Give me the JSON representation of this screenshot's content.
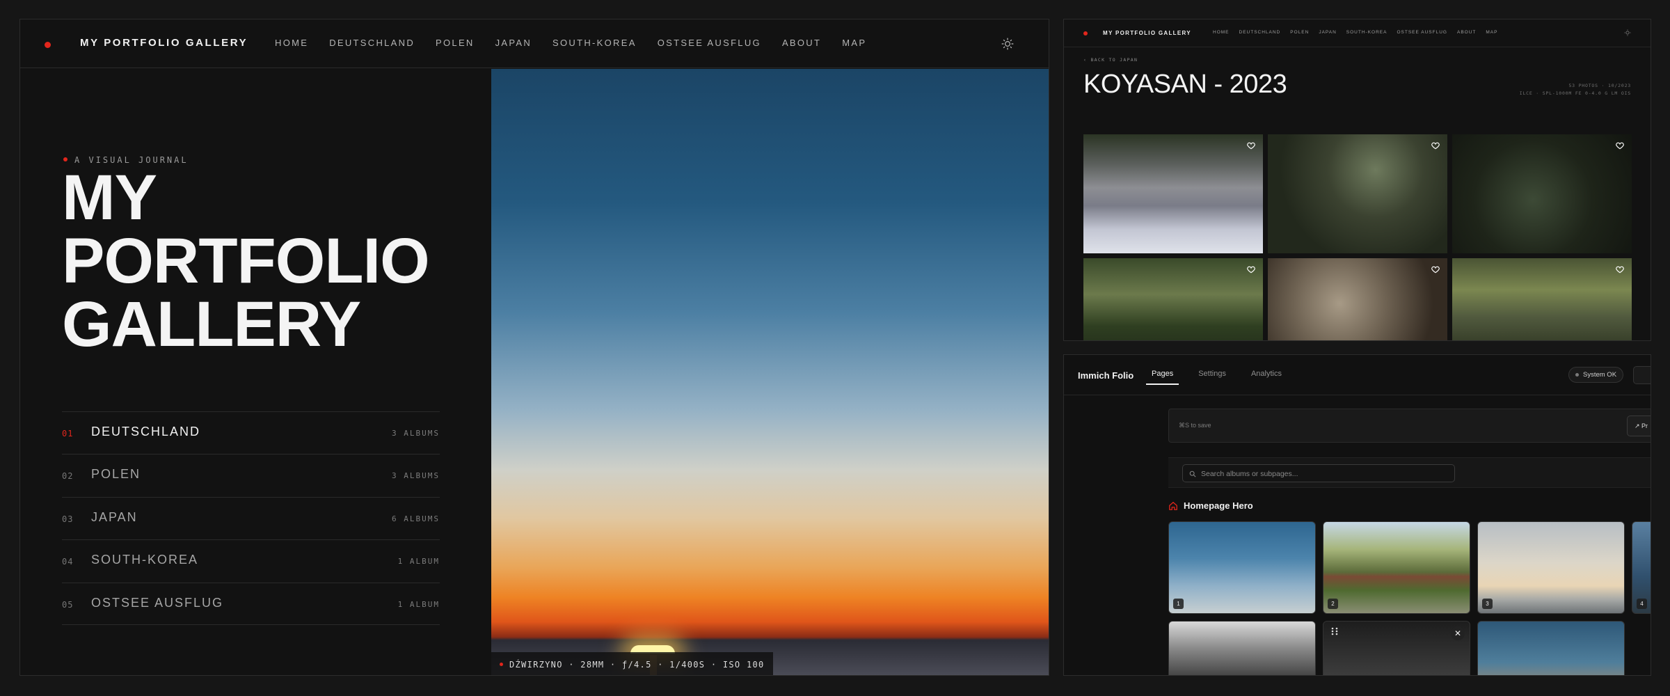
{
  "site": {
    "brand": "MY PORTFOLIO GALLERY",
    "nav": [
      "HOME",
      "DEUTSCHLAND",
      "POLEN",
      "JAPAN",
      "SOUTH-KOREA",
      "OSTSEE AUSFLUG",
      "ABOUT",
      "MAP"
    ],
    "icons": {
      "theme_toggle": "sun-icon",
      "album_like": "heart-icon"
    },
    "accent_color": "#e2261c"
  },
  "home": {
    "kicker": "A VISUAL JOURNAL",
    "title_lines": [
      "MY",
      "PORTFOLIO",
      "GALLERY"
    ],
    "countries": [
      {
        "num": "01",
        "name": "DEUTSCHLAND",
        "count": "3 ALBUMS",
        "active": true
      },
      {
        "num": "02",
        "name": "POLEN",
        "count": "3 ALBUMS",
        "active": false
      },
      {
        "num": "03",
        "name": "JAPAN",
        "count": "6 ALBUMS",
        "active": false
      },
      {
        "num": "04",
        "name": "SOUTH-KOREA",
        "count": "1 ALBUM",
        "active": false
      },
      {
        "num": "05",
        "name": "OSTSEE AUSFLUG",
        "count": "1 ALBUM",
        "active": false
      }
    ],
    "hero_exif": "DŹWIRZYNO · 28MM · ƒ/4.5 · 1/400S · ISO 100"
  },
  "album": {
    "back_label": "BACK TO JAPAN",
    "title": "KOYASAN - 2023",
    "meta_line1": "53 PHOTOS · 10/2023",
    "meta_line2": "ILCE · SPL-1000M FE 0-4.0 G LM OIS",
    "photos": 6
  },
  "cms": {
    "brand": "Immich Folio",
    "tabs": [
      {
        "label": "Pages",
        "active": true
      },
      {
        "label": "Settings",
        "active": false
      },
      {
        "label": "Analytics",
        "active": false
      }
    ],
    "status": "System OK",
    "save_hint": "⌘S to save",
    "preview_label": "↗ Pr",
    "search_placeholder": "Search albums or subpages...",
    "section_title": "Homepage Hero",
    "hero_tiles": [
      "1",
      "2",
      "3",
      "4"
    ]
  }
}
